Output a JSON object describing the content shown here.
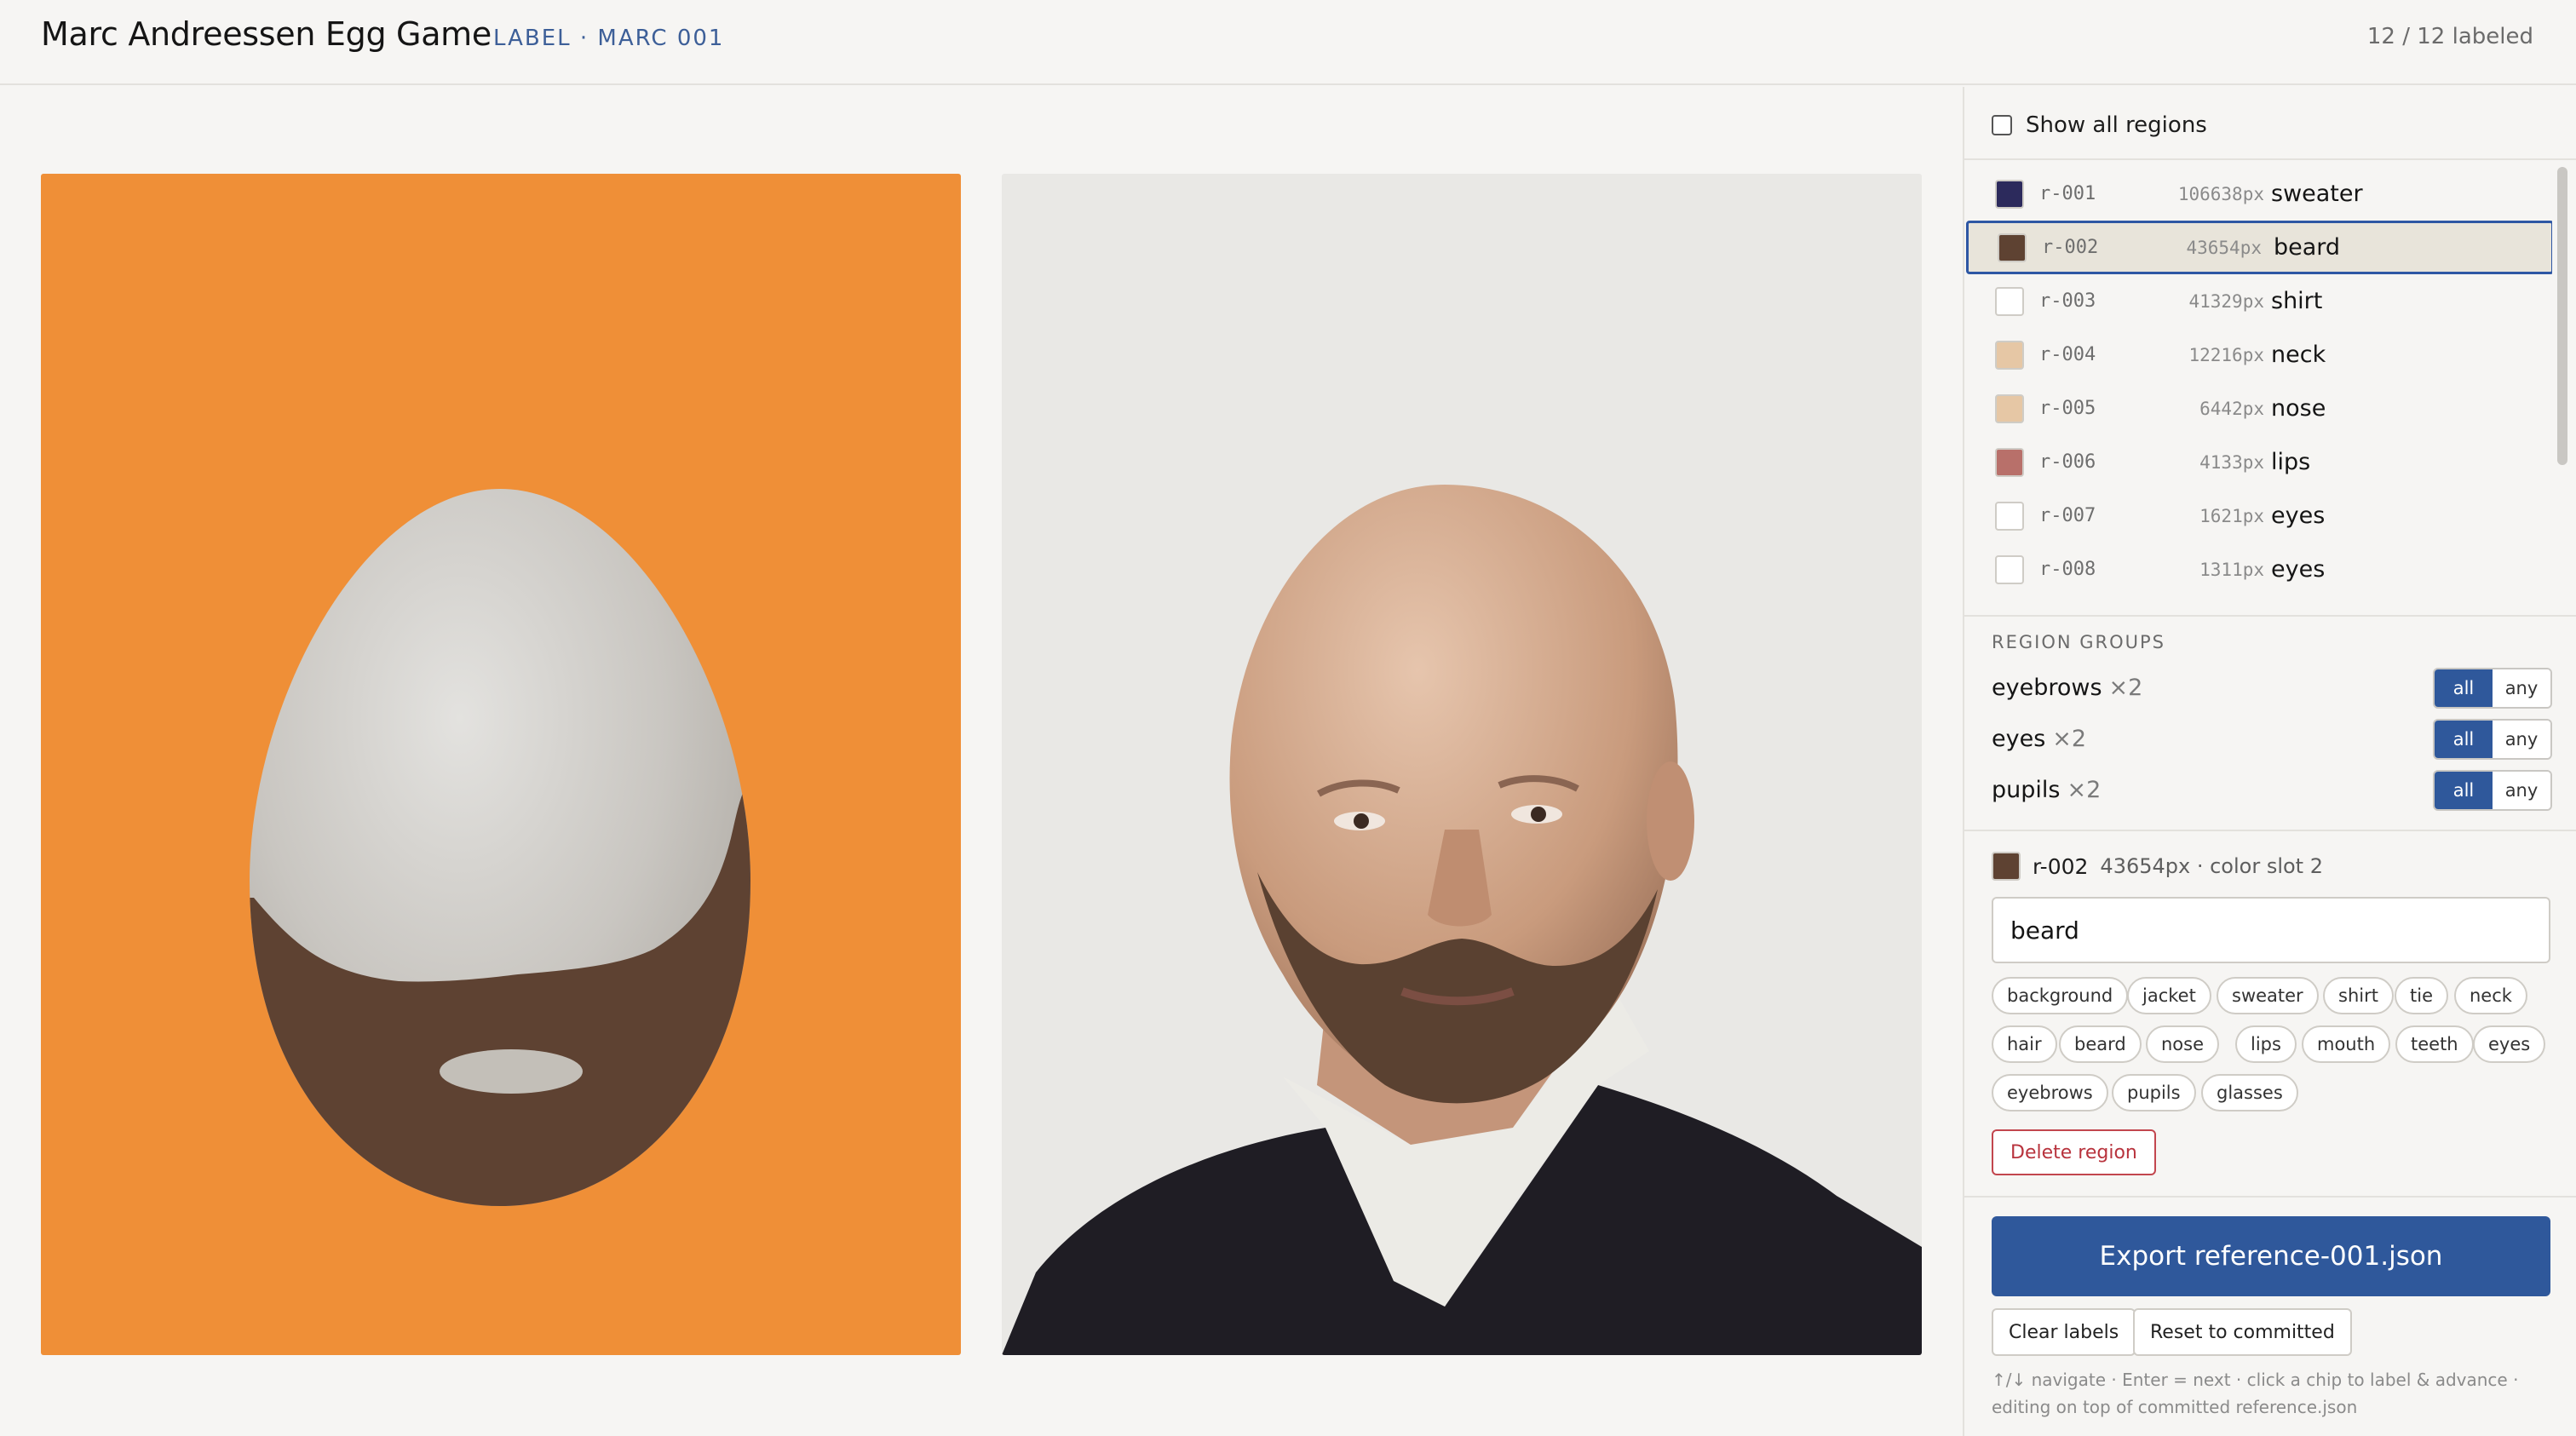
{
  "header": {
    "title": "Marc Andreessen Egg Game",
    "subtitle": "LABEL · MARC 001",
    "progress": "12 / 12 labeled"
  },
  "canvas": {
    "egg_bg": "#ef8f37",
    "egg_shell": "#c4c1bb",
    "beard_color": "#5e4232",
    "photo_bg": "#e9e8e5"
  },
  "sidebar": {
    "show_all_label": "Show all regions",
    "show_all_checked": false,
    "regions": [
      {
        "id": "r-001",
        "px": "106638px",
        "label": "sweater",
        "color": "#2c2a5c"
      },
      {
        "id": "r-002",
        "px": "43654px",
        "label": "beard",
        "color": "#5e4232",
        "selected": true
      },
      {
        "id": "r-003",
        "px": "41329px",
        "label": "shirt",
        "color": "#ffffff"
      },
      {
        "id": "r-004",
        "px": "12216px",
        "label": "neck",
        "color": "#e6c7a5"
      },
      {
        "id": "r-005",
        "px": "6442px",
        "label": "nose",
        "color": "#e6c7a5"
      },
      {
        "id": "r-006",
        "px": "4133px",
        "label": "lips",
        "color": "#b8706a"
      },
      {
        "id": "r-007",
        "px": "1621px",
        "label": "eyes",
        "color": "#ffffff"
      },
      {
        "id": "r-008",
        "px": "1311px",
        "label": "eyes",
        "color": "#ffffff"
      }
    ],
    "groups_title": "REGION GROUPS",
    "groups": [
      {
        "name": "eyebrows",
        "count": "×2",
        "all": "all",
        "any": "any"
      },
      {
        "name": "eyes",
        "count": "×2",
        "all": "all",
        "any": "any"
      },
      {
        "name": "pupils",
        "count": "×2",
        "all": "all",
        "any": "any"
      }
    ],
    "detail": {
      "id": "r-002",
      "meta": "43654px · color slot 2",
      "color": "#5e4232",
      "label_value": "beard"
    },
    "chips": [
      "background",
      "jacket",
      "sweater",
      "shirt",
      "tie",
      "neck",
      "hair",
      "beard",
      "nose",
      "lips",
      "mouth",
      "teeth",
      "eyes",
      "eyebrows",
      "pupils",
      "glasses"
    ],
    "delete_label": "Delete region",
    "export_label": "Export reference-001.json",
    "clear_label": "Clear labels",
    "reset_label": "Reset to committed",
    "hint_line1": "↑/↓ navigate · Enter = next · click a chip to label & advance ·",
    "hint_line2": "editing on top of committed reference.json"
  }
}
